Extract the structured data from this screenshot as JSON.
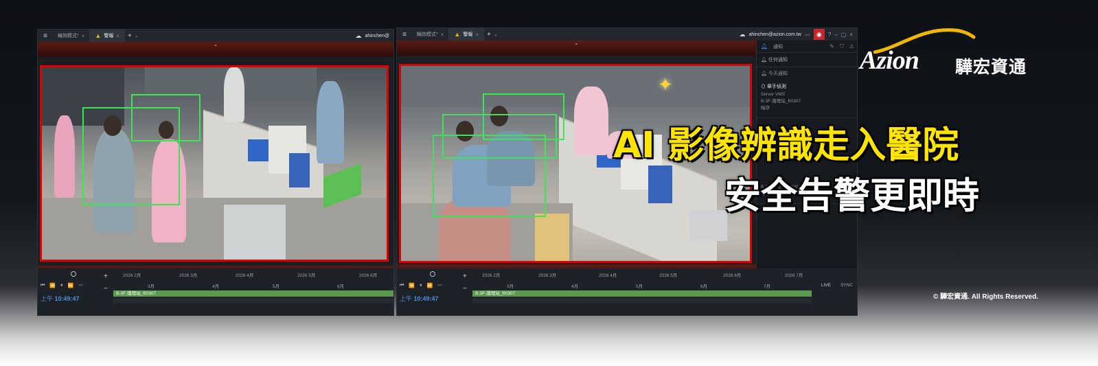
{
  "brand": {
    "logo_word": "Azion",
    "logo_cn": "驊宏資通",
    "copyright": "© 驊宏資通. All Rights Reserved."
  },
  "headline": {
    "line1": "AI 影像辨識走入醫院",
    "line2": "安全告警更即時"
  },
  "colors": {
    "alarm_red": "#e00000",
    "detection_green": "#3ee35a",
    "headline_yellow": "#ffe400",
    "timeline_green": "#5c9a4f",
    "time_blue": "#4d8fd6"
  },
  "icons": {
    "menu": "menu-icon",
    "warning": "warning-icon",
    "cloud": "cloud-icon",
    "record": "record-icon",
    "bell": "bell-icon"
  },
  "left_window": {
    "tabs": [
      {
        "label": "輪詢模式*",
        "active": false
      },
      {
        "label": "警報",
        "active": true
      }
    ],
    "account": "ahinchen@",
    "timeline": {
      "top_months": [
        "2026 2月",
        "2026 3月",
        "2026 4月",
        "2026 5月",
        "2026 6月"
      ],
      "bottom_months": [
        "3月",
        "4月",
        "5月",
        "6月"
      ],
      "time_prefix": "上午",
      "time": "10:49:47",
      "track_label": "B-3F-護理站_B0307"
    }
  },
  "right_window": {
    "tabs": [
      {
        "label": "輪詢模式*",
        "active": false
      },
      {
        "label": "警報",
        "active": true
      }
    ],
    "account": "ahinchen@azion.com.tw",
    "notifications": {
      "header": "通知",
      "filter": "任何通知",
      "section": "今天通知",
      "items": [
        {
          "title": "舉手偵測",
          "server": "Server VMS",
          "camera": "B-3F-護理站_B0307",
          "status": "暗存"
        },
        {
          "title": "",
          "server": "Server",
          "camera": "B-3F-護理站_B0307",
          "status": "暗存"
        }
      ]
    },
    "timeline": {
      "top_months": [
        "2026 2月",
        "2026 3月",
        "2026 4月",
        "2026 5月",
        "2026 6月",
        "2026 7月"
      ],
      "bottom_months": [
        "3月",
        "4月",
        "5月",
        "6月",
        "7月"
      ],
      "time_prefix": "上午",
      "time": "10:49:47",
      "track_label": "B-3F-護理站_B0307",
      "live": "LIVE",
      "sync": "SYNC"
    }
  }
}
